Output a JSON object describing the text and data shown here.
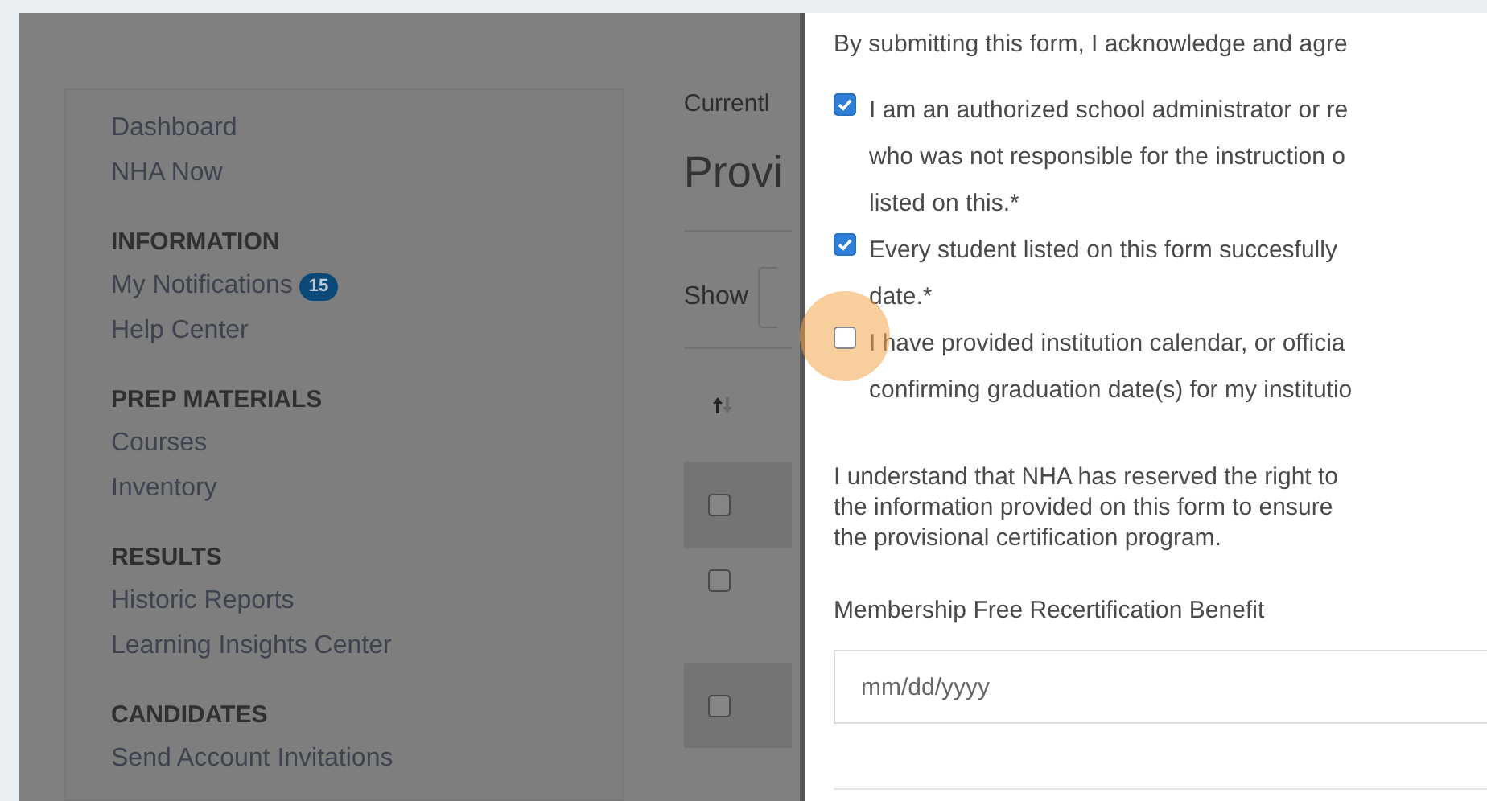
{
  "sidebar": {
    "sections": [
      {
        "items": [
          {
            "label": "Dashboard"
          },
          {
            "label": "NHA Now"
          }
        ]
      },
      {
        "heading": "INFORMATION",
        "items": [
          {
            "label": "My Notifications",
            "badge": "15"
          },
          {
            "label": "Help Center"
          }
        ]
      },
      {
        "heading": "PREP MATERIALS",
        "items": [
          {
            "label": "Courses"
          },
          {
            "label": "Inventory"
          }
        ]
      },
      {
        "heading": "RESULTS",
        "items": [
          {
            "label": "Historic Reports"
          },
          {
            "label": "Learning Insights Center"
          }
        ]
      },
      {
        "heading": "CANDIDATES",
        "items": [
          {
            "label": "Send Account Invitations"
          }
        ]
      }
    ]
  },
  "main": {
    "breadcrumb": "Currentl",
    "title": "Provi",
    "show_label": "Show",
    "table": {
      "rows": [
        {
          "checked": false,
          "shaded": true
        },
        {
          "checked": false,
          "shaded": false
        },
        {
          "checked": false,
          "shaded": true
        }
      ]
    }
  },
  "modal": {
    "intro": "By submitting this form, I acknowledge and agre",
    "agreements": [
      {
        "checked": true,
        "focused": false,
        "lines": [
          "I am an authorized school administrator or re",
          "who was not responsible for the instruction o",
          "listed on this.*"
        ]
      },
      {
        "checked": true,
        "focused": false,
        "lines": [
          "Every student listed on this form succesfully",
          "date.*"
        ]
      },
      {
        "checked": false,
        "focused": true,
        "lines": [
          "I have provided institution calendar, or officia",
          "confirming graduation date(s) for my institutio"
        ]
      }
    ],
    "notice": [
      "I understand that NHA has reserved the right to",
      "the information provided on this form to ensure",
      "the provisional certification program."
    ],
    "date_field": {
      "label": "Membership Free Recertification Benefit",
      "placeholder": "mm/dd/yyyy"
    }
  }
}
